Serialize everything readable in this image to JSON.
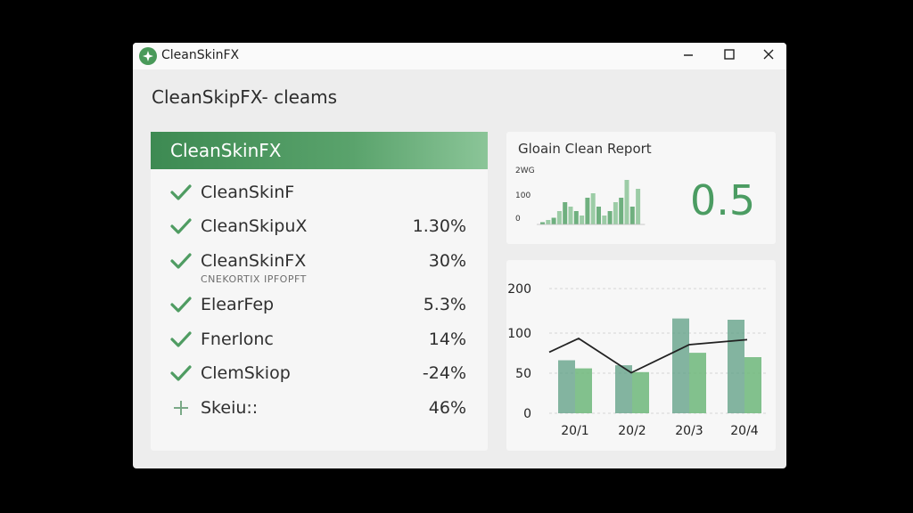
{
  "window": {
    "title": "CleanSkinFX"
  },
  "page": {
    "heading": "CleanSkipFX- cleams"
  },
  "list_panel": {
    "header": "CleanSkinFX",
    "items": [
      {
        "icon": "check-icon",
        "label": "CleanSkinF",
        "value": ""
      },
      {
        "icon": "check-icon",
        "label": "CleanSkipuX",
        "value": "1.30%"
      },
      {
        "icon": "check-icon",
        "label": "CleanSkinFX",
        "value": "30%",
        "sublabel": "CNEKORTIX IPFOPFT"
      },
      {
        "icon": "check-icon",
        "label": "ElearFep",
        "value": "5.3%"
      },
      {
        "icon": "check-icon",
        "label": "Fnerlonc",
        "value": "14%"
      },
      {
        "icon": "check-icon",
        "label": "ClemSkiop",
        "value": "-24%"
      },
      {
        "icon": "plus-icon",
        "label": "Skeiu::",
        "value": "46%"
      }
    ]
  },
  "report_card": {
    "title": "Gloain Clean Report",
    "big_value": "0.5",
    "chart_data": {
      "type": "bar",
      "title": "",
      "y_tick_labels": [
        "2WG",
        "100",
        "0"
      ],
      "series": [
        {
          "values": [
            5,
            10,
            15,
            30,
            50,
            40,
            30,
            20,
            60,
            70,
            40,
            20,
            30,
            50,
            60,
            100,
            40,
            80
          ]
        }
      ],
      "colors": [
        "#6fb07f",
        "#9ccca6"
      ]
    }
  },
  "trend_chart": {
    "chart_data": {
      "type": "bar",
      "categories": [
        "20/1",
        "20/2",
        "20/3",
        "20/4"
      ],
      "ylim": [
        0,
        200
      ],
      "y_ticks": [
        "200",
        "100",
        "50",
        "0"
      ],
      "grid": true,
      "series": [
        {
          "values": [
            85,
            77,
            152,
            150
          ]
        },
        {
          "values": [
            72,
            66,
            97,
            90
          ]
        }
      ],
      "line": {
        "values": [
          98,
          120,
          65,
          110,
          118
        ]
      }
    }
  },
  "colors": {
    "accent": "#4a9a5a",
    "header_start": "#3d8a52",
    "header_end": "#8bc598",
    "bar_dark": "#5c9d83",
    "bar_light": "#6db77a"
  }
}
